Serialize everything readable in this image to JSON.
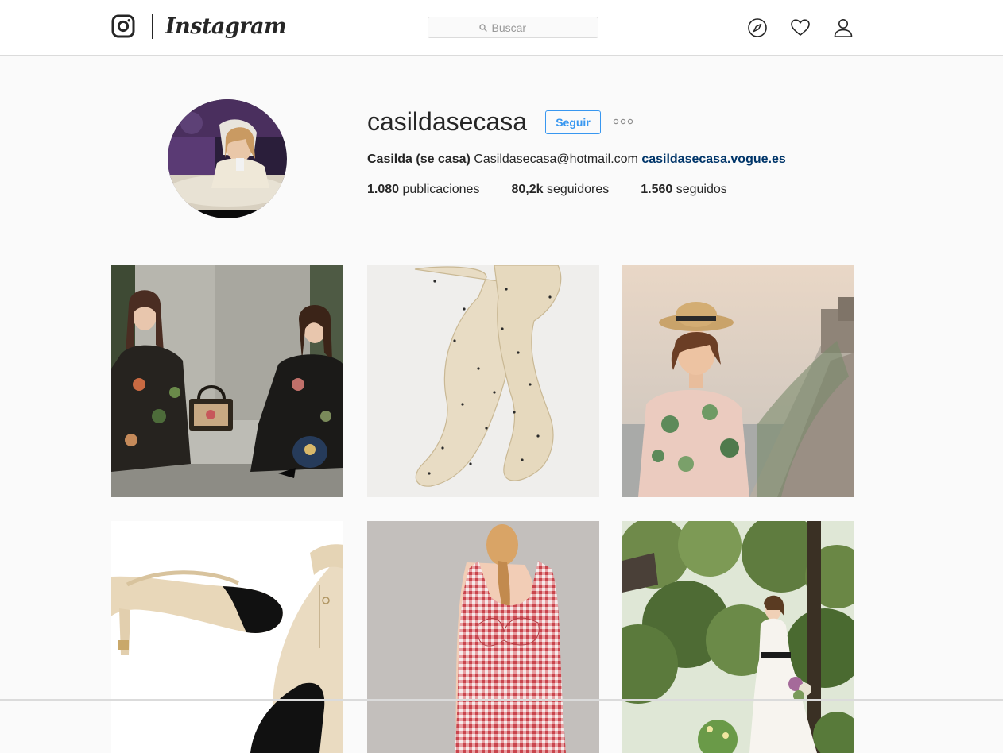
{
  "header": {
    "brand_icon": "instagram-camera-icon",
    "brand_name": "Instagram",
    "search": {
      "placeholder": "Buscar",
      "icon": "search-icon"
    },
    "nav_icons": [
      "compass-icon",
      "heart-icon",
      "person-icon"
    ]
  },
  "profile": {
    "username": "casildasecasa",
    "follow_label": "Seguir",
    "more_icon": "ellipsis-icon",
    "full_name": "Casilda (se casa)",
    "email": "Casildasecasa@hotmail.com",
    "website": "casildasecasa.vogue.es",
    "stats": {
      "posts_count": "1.080",
      "posts_label": "publicaciones",
      "followers_count": "80,2k",
      "followers_label": "seguidores",
      "following_count": "1.560",
      "following_label": "seguidos"
    }
  },
  "colors": {
    "accent_blue": "#3897f0",
    "link_blue": "#003569",
    "text": "#262626",
    "page_bg": "#fafafa",
    "border": "#dbdbdb"
  }
}
